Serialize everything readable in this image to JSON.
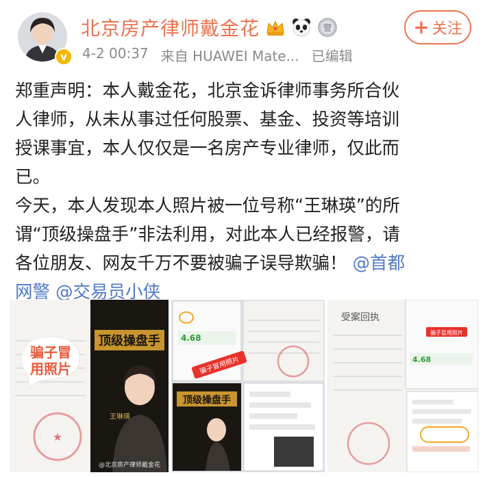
{
  "user": {
    "name": "北京房产律师戴金花",
    "verified_mark": "v",
    "badges": [
      "crown-badge",
      "panda-icon",
      "medal-badge"
    ],
    "medal_char": "誉"
  },
  "meta": {
    "time": "4-2 00:37",
    "source": "来自 HUAWEI Mate...",
    "edited": "已编辑"
  },
  "follow": {
    "plus": "+",
    "label": "关注"
  },
  "post": {
    "lines": [
      "郑重声明：本人戴金花，北京金诉律师事务所合伙",
      "人律师，从未从事过任何股票、基金、投资等培训",
      "授课事宜，本人仅仅是一名房产专业律师，仅此而",
      "已。",
      "今天，本人发现本人照片被一位号称“王琳瑛”的所",
      "谓“顶级操盘手”非法利用，对此本人已经报警，请",
      "各位朋友、网友千万不要被骗子误导欺骗！"
    ],
    "mention1": "@首都",
    "mention1_cont": "网警",
    "mention2": "@交易员小侠"
  },
  "images": {
    "sticker": [
      "骗子冒",
      "用照片"
    ],
    "poster_title": "顶级操盘手",
    "poster_name": "王琳瑛",
    "watermark": "@北京房产律师戴金花",
    "doc1_title": "受案回执",
    "phone_label": "骗子冒用照片",
    "tag": "骗子冒用照片"
  },
  "colors": {
    "accent": "#eb7350",
    "mention": "#5079c8",
    "meta": "#8a8a8a"
  }
}
